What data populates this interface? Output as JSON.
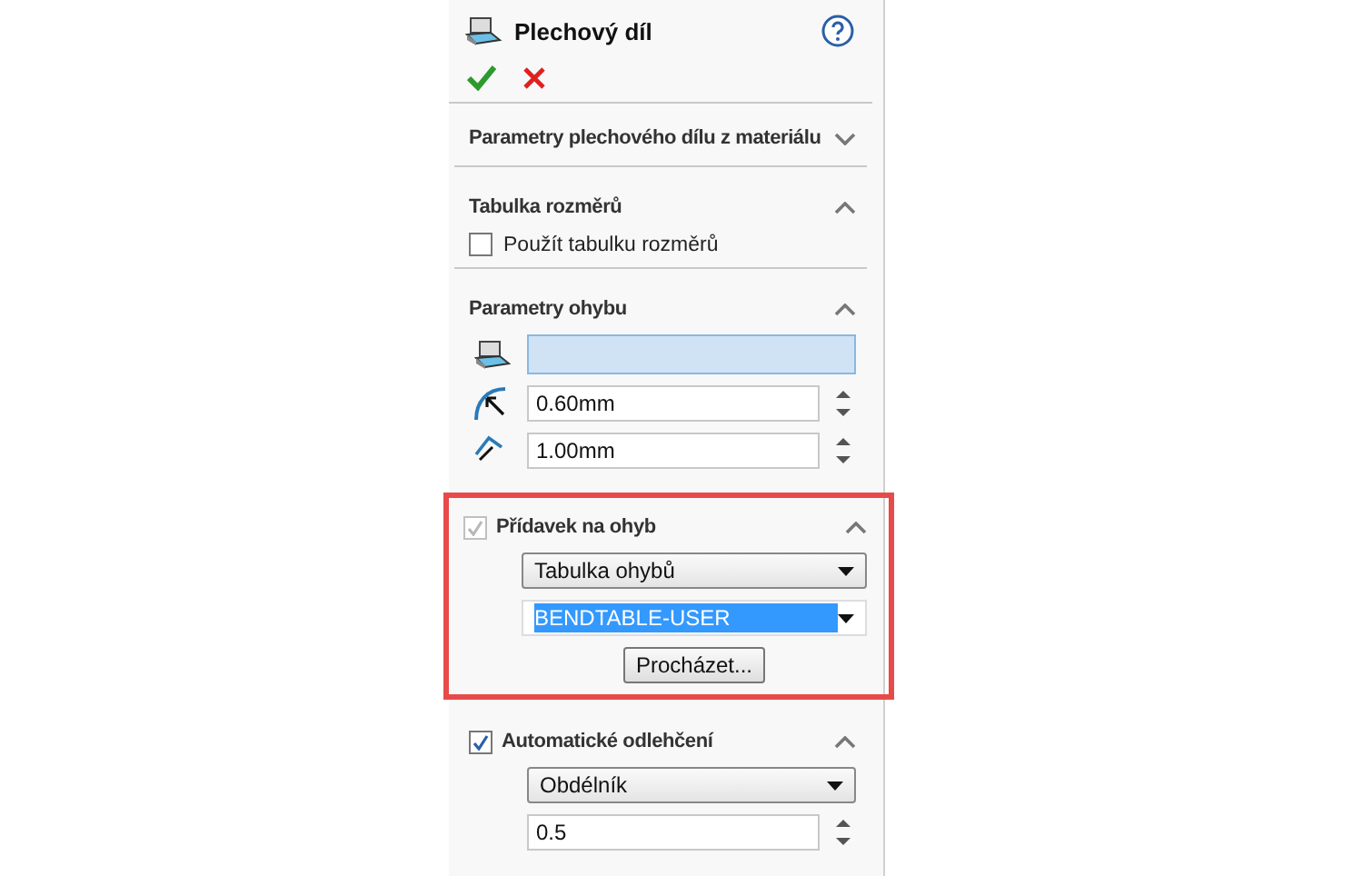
{
  "panel": {
    "title": "Plechový díl"
  },
  "sections": [
    {
      "title": "Parametry plechového dílu z materiálu",
      "expanded": false,
      "highlighted": false
    },
    {
      "title": "Tabulka rozměrů",
      "expanded": true,
      "highlighted": false,
      "items": [
        {
          "kind": "checkbox",
          "label": "Použít tabulku rozměrů",
          "checked": false
        }
      ]
    },
    {
      "title": "Parametry ohybu",
      "expanded": true,
      "highlighted": false,
      "items": [
        {
          "kind": "selection"
        },
        {
          "kind": "radius",
          "value": "0.60mm"
        },
        {
          "kind": "thickness",
          "value": "1.00mm"
        }
      ]
    },
    {
      "title": "Přídavek na ohyb",
      "check": {
        "checked": true,
        "disabled": true
      },
      "expanded": true,
      "highlighted": true,
      "items": [
        {
          "kind": "select",
          "value": "Tabulka ohybů"
        },
        {
          "kind": "combo",
          "value": "BENDTABLE-USER",
          "text_selected": true
        },
        {
          "kind": "button",
          "label": "Procházet..."
        }
      ]
    },
    {
      "title": "Automatické odlehčení",
      "check": {
        "checked": true,
        "disabled": false
      },
      "expanded": true,
      "highlighted": false,
      "items": [
        {
          "kind": "select",
          "value": "Obdélník"
        },
        {
          "kind": "spin",
          "value": "0.5"
        }
      ]
    }
  ]
}
